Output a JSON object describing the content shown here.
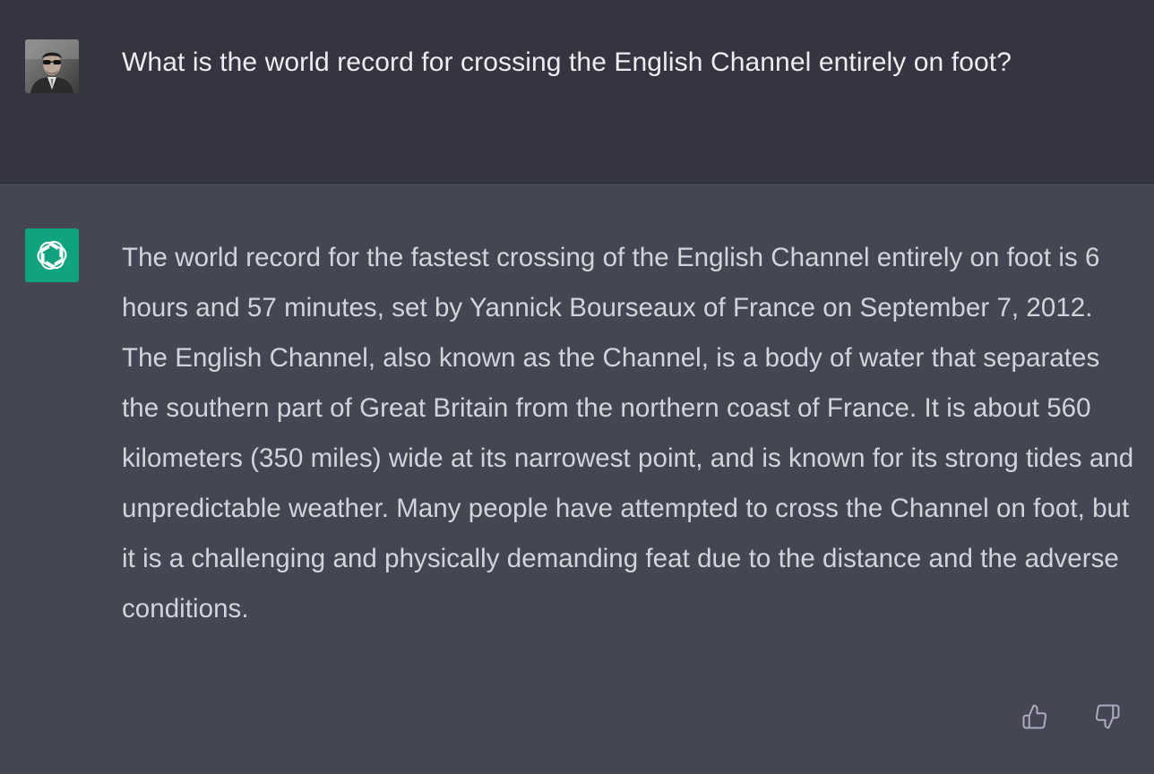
{
  "conversation": {
    "user": {
      "avatar_icon": "user-photo-avatar",
      "message": "What is the world record for crossing the English Channel entirely on foot?"
    },
    "assistant": {
      "avatar_icon": "openai-logo-icon",
      "accent_color": "#10a37f",
      "message": "The world record for the fastest crossing of the English Channel entirely on foot is 6 hours and 57 minutes, set by Yannick Bourseaux of France on September 7, 2012. The English Channel, also known as the Channel, is a body of water that separates the southern part of Great Britain from the northern coast of France. It is about 560 kilometers (350 miles) wide at its narrowest point, and is known for its strong tides and unpredictable weather. Many people have attempted to cross the Channel on foot, but it is a challenging and physically demanding feat due to the distance and the adverse conditions."
    },
    "feedback": {
      "up_icon": "thumbs-up-icon",
      "down_icon": "thumbs-down-icon"
    }
  },
  "colors": {
    "user_bg": "#343541",
    "assistant_bg": "#444654",
    "text": "#ececf1"
  }
}
